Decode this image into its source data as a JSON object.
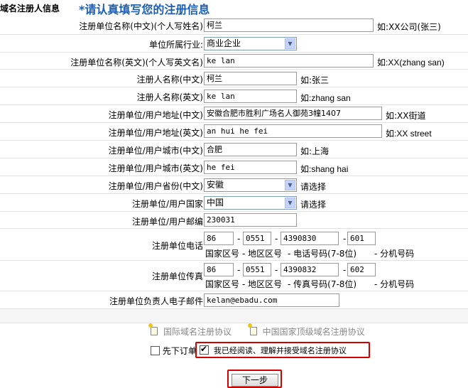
{
  "header": {
    "section": "域名注册人信息",
    "notice": "*请认真填写您的注册信息"
  },
  "rows": [
    {
      "label": "注册单位名称(中文)(个人写姓名)",
      "value": "柯兰",
      "hint": "如:XX公司(张三)"
    },
    {
      "label": "单位所属行业:",
      "select": "商业企业"
    },
    {
      "label": "注册单位名称(英文)(个人写英文名)",
      "value": "ke lan",
      "hint": "如:XX(zhang san)"
    },
    {
      "label": "注册人名称(中文)",
      "value": "柯兰",
      "hint": "如:张三"
    },
    {
      "label": "注册人名称(英文)",
      "value": "ke lan",
      "hint": "如:zhang san"
    },
    {
      "label": "注册单位/用户地址(中文)",
      "value": "安徽合肥市胜利广场名人御苑3幢1407",
      "hint": "如:XX街道"
    },
    {
      "label": "注册单位/用户地址(英文)",
      "value": "an hui he fei",
      "hint": "如:XX street"
    },
    {
      "label": "注册单位/用户城市(中文)",
      "value": "合肥",
      "hint": "如:上海"
    },
    {
      "label": "注册单位/用户城市(英文)",
      "value": "he fei",
      "hint": "如:shang hai"
    },
    {
      "label": "注册单位/用户省份(中文)",
      "select": "安徽",
      "hint": "请选择"
    },
    {
      "label": "注册单位/用户国家",
      "select": "中国",
      "hint": "请选择"
    },
    {
      "label": "注册单位/用户邮编",
      "value": "230031"
    }
  ],
  "phone": {
    "label": "注册单位电话",
    "country": "86",
    "area": "0551",
    "number": "4390830",
    "ext": "601"
  },
  "fax": {
    "label": "注册单位传真",
    "country": "86",
    "area": "0551",
    "number": "4390832",
    "ext": "602"
  },
  "sublabels": {
    "country": "国家区号",
    "area": "- 地区区号",
    "number": "-  电话号码(7-8位)",
    "fax_number": "-  传真号码(7-8位)",
    "ext": "- 分机号码",
    "dash": "-"
  },
  "email": {
    "label": "注册单位负责人电子邮件",
    "value": "kelan@ebadu.com"
  },
  "agreements": {
    "intl": "国际域名注册协议",
    "cn": "中国国家顶级域名注册协议"
  },
  "options": {
    "preorder_label": "先下订单",
    "preorder_checked": false,
    "accept_label": "我已经阅读、理解并接受域名注册协议",
    "accept_checked": true
  },
  "submit_label": "下一步",
  "colors": {
    "notice": "#1a5fb4",
    "highlight": "#d40000"
  }
}
